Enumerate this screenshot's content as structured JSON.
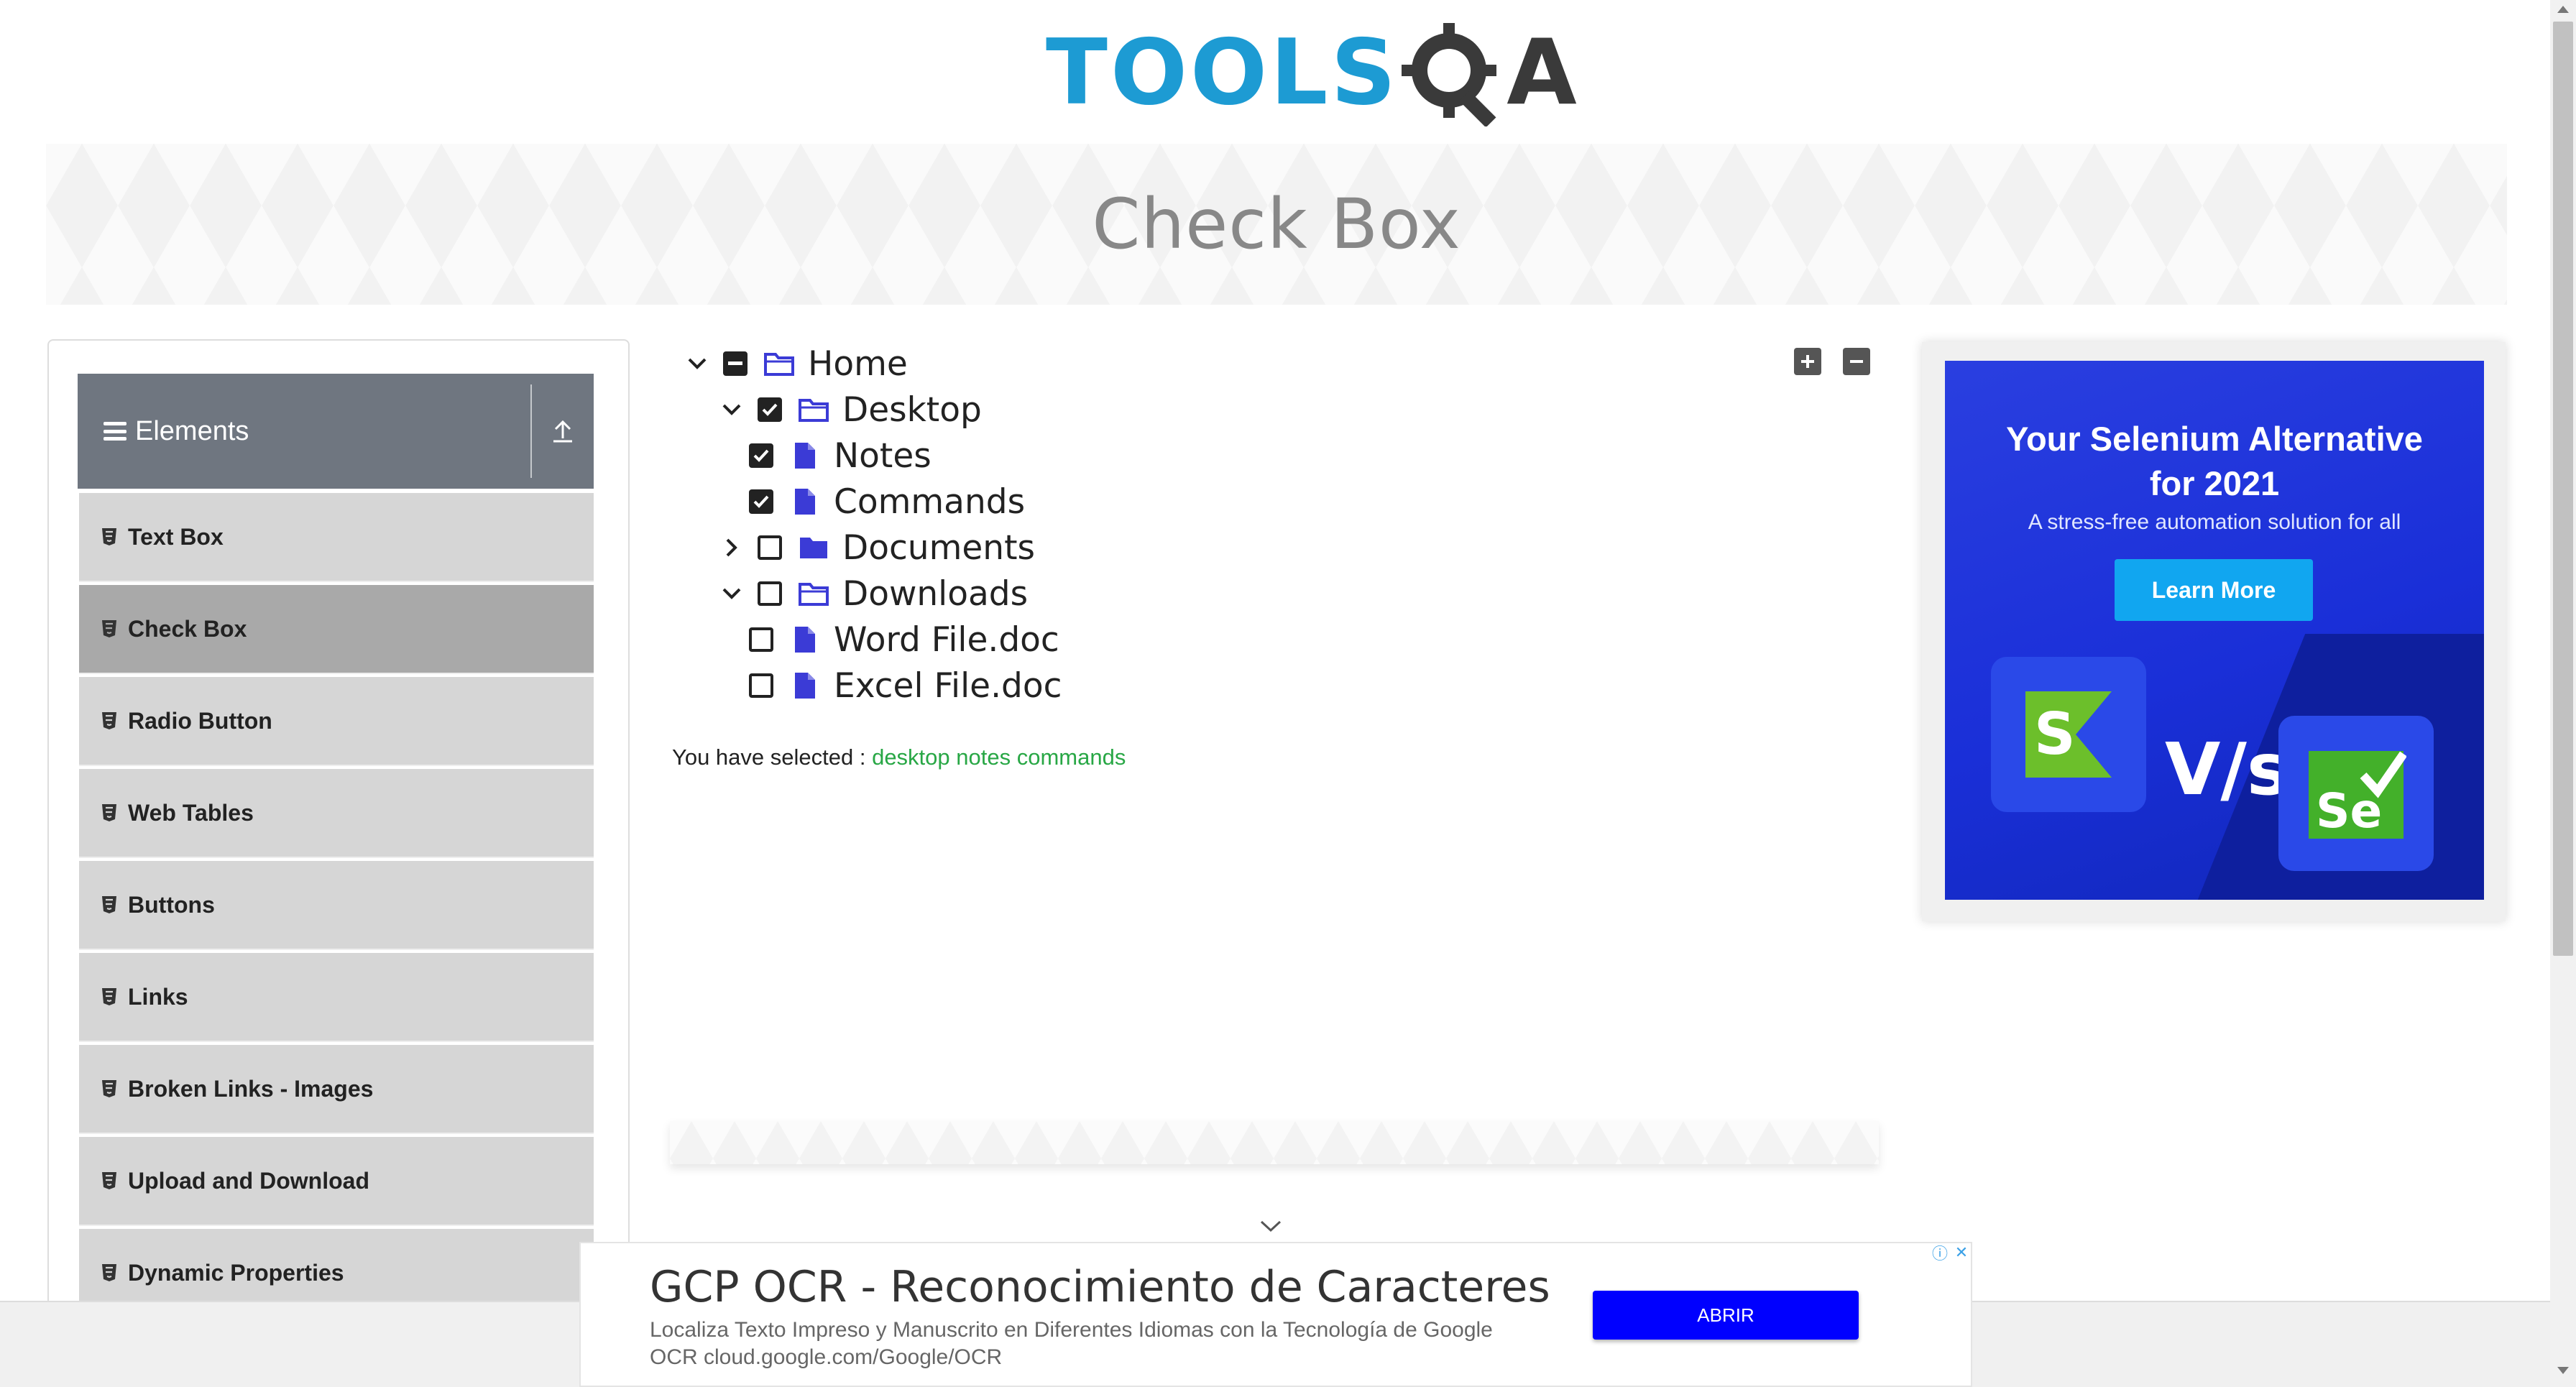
{
  "logo": {
    "tools": "TOOLS",
    "q": "Q",
    "a": "A"
  },
  "banner": {
    "title": "Check Box"
  },
  "sidebar": {
    "group_title": "Elements",
    "items": [
      {
        "label": "Text Box"
      },
      {
        "label": "Check Box",
        "active": true
      },
      {
        "label": "Radio Button"
      },
      {
        "label": "Web Tables"
      },
      {
        "label": "Buttons"
      },
      {
        "label": "Links"
      },
      {
        "label": "Broken Links - Images"
      },
      {
        "label": "Upload and Download"
      },
      {
        "label": "Dynamic Properties"
      }
    ]
  },
  "tree": {
    "nodes": [
      {
        "label": "Home",
        "state": "half",
        "expanded": true,
        "type": "folder-open"
      },
      {
        "label": "Desktop",
        "state": "checked",
        "expanded": true,
        "type": "folder-open"
      },
      {
        "label": "Notes",
        "state": "checked",
        "type": "file"
      },
      {
        "label": "Commands",
        "state": "checked",
        "type": "file"
      },
      {
        "label": "Documents",
        "state": "unchecked",
        "expanded": false,
        "type": "folder-closed"
      },
      {
        "label": "Downloads",
        "state": "unchecked",
        "expanded": true,
        "type": "folder-open"
      },
      {
        "label": "Word File.doc",
        "state": "unchecked",
        "type": "file"
      },
      {
        "label": "Excel File.doc",
        "state": "unchecked",
        "type": "file"
      }
    ],
    "expand_all_icon": "plus-square-icon",
    "collapse_all_icon": "minus-square-icon"
  },
  "result": {
    "prefix": "You have selected :",
    "selected": "desktop notes commands"
  },
  "side_ad": {
    "title_line1": "Your Selenium Alternative",
    "title_line2": "for 2021",
    "subtitle": "A stress-free automation solution for all",
    "button": "Learn More",
    "vs": "V/s",
    "logo_left": "S",
    "logo_right": "Se"
  },
  "bottom_ad": {
    "title": "GCP OCR - Reconocimiento de Caracteres",
    "description": "Localiza Texto Impreso y Manuscrito en Diferentes Idiomas con la Tecnología de Google OCR cloud.google.com/Google/OCR",
    "button": "ABRIR"
  },
  "colors": {
    "brand_blue": "#1d9bd3",
    "sidebar_header": "#6f7680",
    "menu_item": "#d6d6d6",
    "menu_item_active": "#a9a9a9",
    "selected_text": "#28a745",
    "tree_icon": "#3b3bd6",
    "ad_blue": "#1a2fd8",
    "ad_button": "#11a6f0"
  }
}
